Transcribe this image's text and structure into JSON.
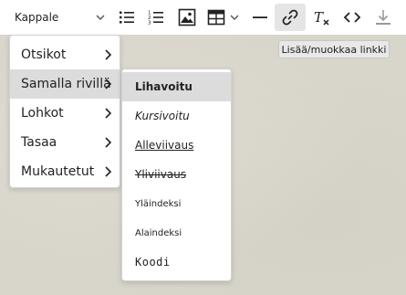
{
  "toolbar": {
    "block_format": "Kappale",
    "icons": [
      "bullet-list-icon",
      "numbered-list-icon",
      "image-icon",
      "table-icon",
      "horizontal-line-icon",
      "link-icon",
      "clear-format-icon",
      "code-icon",
      "download-icon"
    ],
    "tooltip": "Lisää/muokkaa linkki"
  },
  "format_menu": {
    "items": [
      {
        "label": "Otsikot"
      },
      {
        "label": "Samalla rivillä"
      },
      {
        "label": "Lohkot"
      },
      {
        "label": "Tasaa"
      },
      {
        "label": "Mukautetut"
      }
    ]
  },
  "inline_menu": {
    "items": [
      {
        "label": "Lihavoitu"
      },
      {
        "label": "Kursivoitu"
      },
      {
        "label": "Alleviivaus"
      },
      {
        "label": "Yliviivaus"
      },
      {
        "label": "Yläindeksi"
      },
      {
        "label": "Alaindeksi"
      },
      {
        "label": "Koodi"
      }
    ]
  },
  "colors": {
    "toolbar_bg": "#ffffff",
    "highlight": "#dcdcdc",
    "active_button": "#e5e5e5",
    "background": "#d8d5cb"
  }
}
